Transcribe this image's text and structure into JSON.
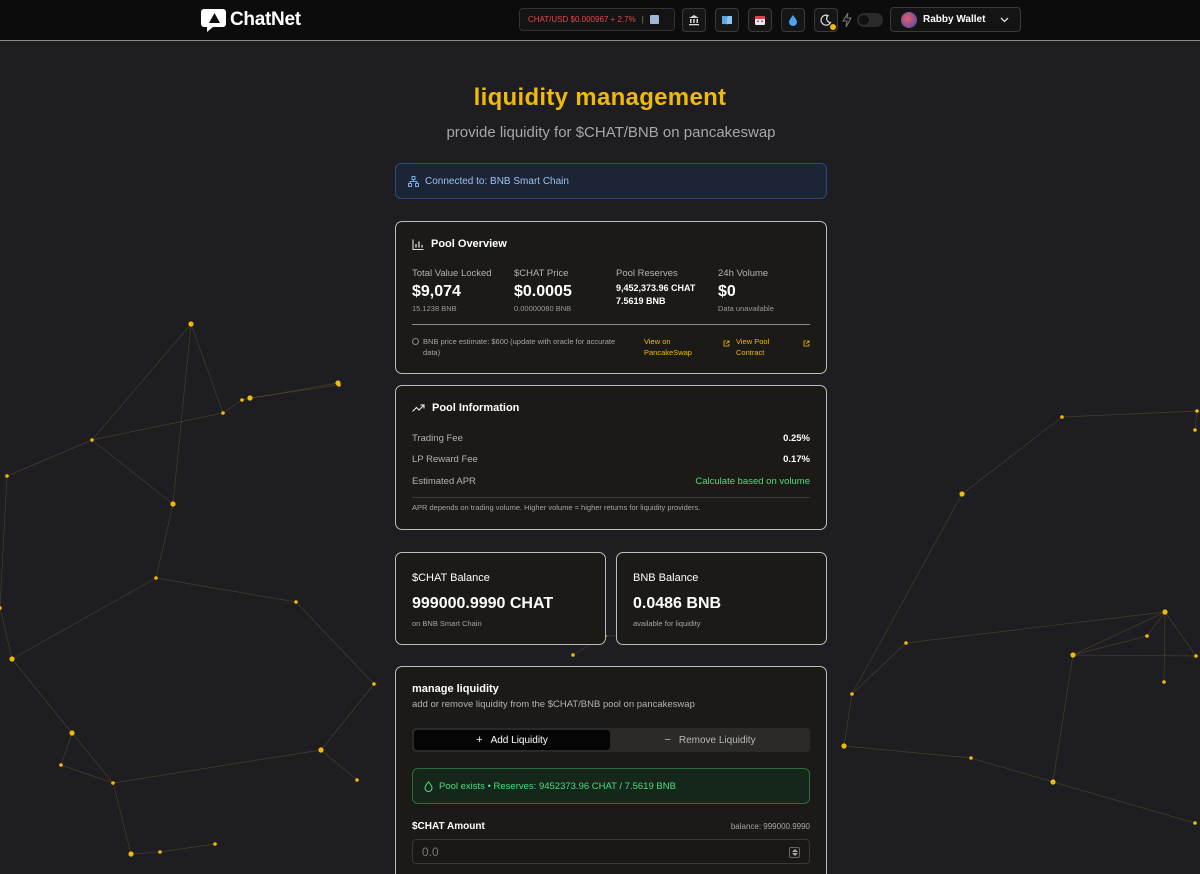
{
  "header": {
    "logo_text": "ChatNet",
    "ticker": {
      "label": "CHAT/USD $0.000967 + 2.7%",
      "separator": "|"
    },
    "icons": [
      "bank-icon",
      "book-icon",
      "calendar-icon",
      "droplet-icon",
      "moon-icon",
      "bolt-icon"
    ],
    "wallet_label": "Rabby Wallet"
  },
  "page": {
    "title": "liquidity management",
    "subtitle": "provide liquidity for $CHAT/BNB on pancakeswap",
    "connected": "Connected to: BNB Smart Chain"
  },
  "overview": {
    "title": "Pool Overview",
    "tvl": {
      "label": "Total Value Locked",
      "value": "$9,074",
      "sub": "15.1238 BNB"
    },
    "price": {
      "label": "$CHAT Price",
      "value": "$0.0005",
      "sub": "0.00000080 BNB"
    },
    "reserves": {
      "label": "Pool Reserves",
      "chat": "9,452,373.96 CHAT",
      "bnb": "7.5619 BNB"
    },
    "volume": {
      "label": "24h Volume",
      "value": "$0",
      "sub": "Data unavailable"
    },
    "note": "BNB price estimate: $600 (update with oracle for accurate data)",
    "link_pancake": "View on PancakeSwap",
    "link_contract": "View Pool Contract"
  },
  "pool_info": {
    "title": "Pool Information",
    "rows": [
      {
        "label": "Trading Fee",
        "value": "0.25%"
      },
      {
        "label": "LP Reward Fee",
        "value": "0.17%"
      },
      {
        "label": "Estimated APR",
        "value": "Calculate based on volume"
      }
    ],
    "note": "APR depends on trading volume. Higher volume = higher returns for liquidity providers."
  },
  "balances": {
    "chat": {
      "title": "$CHAT Balance",
      "value": "999000.9990 CHAT",
      "sub": "on BNB Smart Chain"
    },
    "bnb": {
      "title": "BNB Balance",
      "value": "0.0486 BNB",
      "sub": "available for liquidity"
    }
  },
  "manage": {
    "title": "manage liquidity",
    "subtitle": "add or remove liquidity from the $CHAT/BNB pool on pancakeswap",
    "tab_add": "Add Liquidity",
    "tab_remove": "Remove Liquidity",
    "pool_status": "Pool exists • Reserves: 9452373.96 CHAT / 7.5619 BNB",
    "amount_label": "$CHAT Amount",
    "amount_balance": "balance: 999000.9990",
    "amount_placeholder": "0.0"
  },
  "colors": {
    "accent": "#f0b90b",
    "success": "#4ade80",
    "info": "#9cc0ef",
    "ticker_down": "#e24a4a"
  }
}
